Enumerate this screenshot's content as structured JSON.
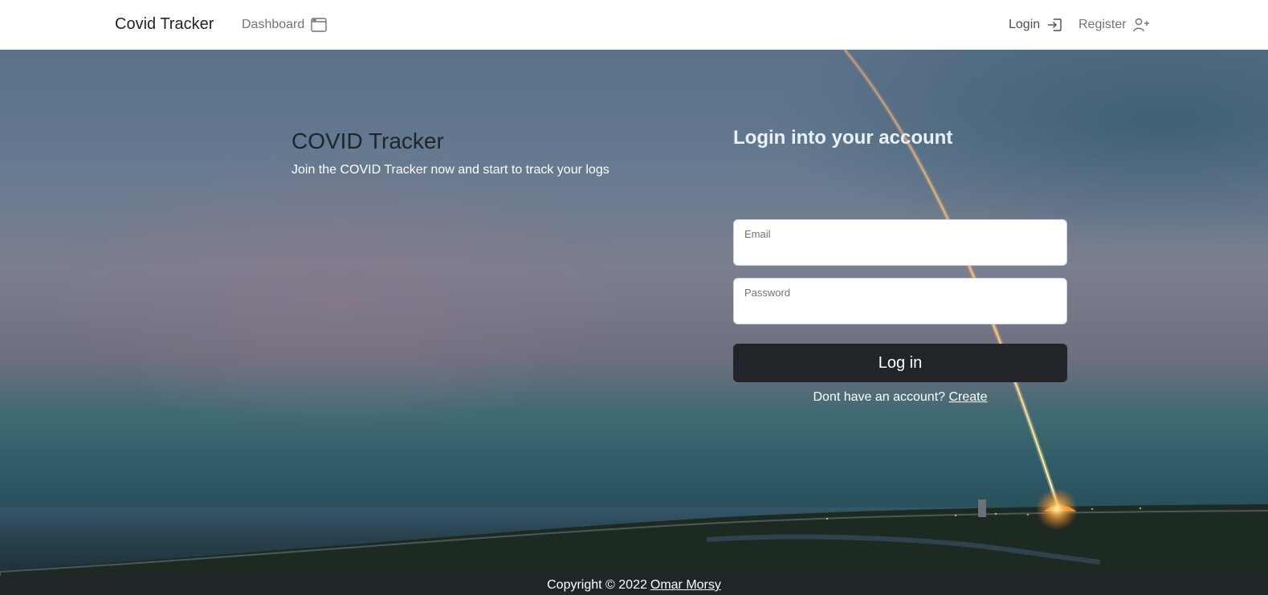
{
  "navbar": {
    "brand": "Covid Tracker",
    "links": {
      "dashboard": {
        "label": "Dashboard",
        "icon": "window-icon"
      },
      "login": {
        "label": "Login",
        "icon": "box-arrow-in-right-icon"
      },
      "register": {
        "label": "Register",
        "icon": "person-plus-icon"
      }
    }
  },
  "hero": {
    "title": "COVID Tracker",
    "subtitle": "Join the COVID Tracker now and start to track your logs"
  },
  "login_form": {
    "heading": "Login into your account",
    "email_label": "Email",
    "email_value": "",
    "password_label": "Password",
    "password_value": "",
    "submit_label": "Log in",
    "signup_prompt": "Dont have an account?",
    "signup_link": "Create"
  },
  "footer": {
    "copyright": "Copyright © 2022",
    "author": "Omar Morsy"
  },
  "colors": {
    "navbar_bg": "#ffffff",
    "button_dark": "#212529",
    "footer_bg": "#212529",
    "heading_light": "#e9f1fb"
  }
}
